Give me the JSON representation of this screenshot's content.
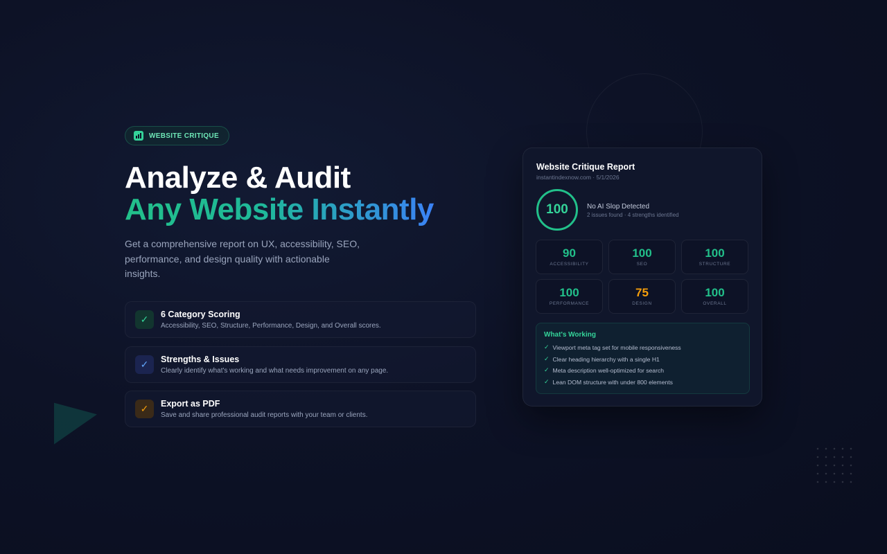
{
  "badge": {
    "label": "WEBSITE CRITIQUE"
  },
  "hero": {
    "title_line1": "Analyze & Audit",
    "title_line2": "Any Website Instantly",
    "lede": "Get a comprehensive report on UX, accessibility, SEO, performance, and design quality with actionable insights."
  },
  "features": [
    {
      "title": "6 Category Scoring",
      "desc": "Accessibility, SEO, Structure, Performance, Design, and Overall scores.",
      "icon": "check-icon",
      "color": "#34d399"
    },
    {
      "title": "Strengths & Issues",
      "desc": "Clearly identify what's working and what needs improvement on any page.",
      "icon": "check-icon",
      "color": "#60a5fa"
    },
    {
      "title": "Export as PDF",
      "desc": "Save and share professional audit reports with your team or clients.",
      "icon": "check-icon",
      "color": "#f59e0b"
    }
  ],
  "report": {
    "title": "Website Critique Report",
    "meta": "instantindexnow.com · 5/1/2026",
    "overall_score": "100",
    "verdict": "No AI Slop Detected",
    "verdict_sub": "2 issues found · 4 strengths identified",
    "scores": [
      {
        "value": "90",
        "label": "ACCESSIBILITY",
        "color": "#22c08a"
      },
      {
        "value": "100",
        "label": "SEO",
        "color": "#22c08a"
      },
      {
        "value": "100",
        "label": "STRUCTURE",
        "color": "#22c08a"
      },
      {
        "value": "100",
        "label": "PERFORMANCE",
        "color": "#22c08a"
      },
      {
        "value": "75",
        "label": "DESIGN",
        "color": "#f59e0b"
      },
      {
        "value": "100",
        "label": "OVERALL",
        "color": "#22c08a"
      }
    ],
    "working_title": "What's Working",
    "working_items": [
      "Viewport meta tag set for mobile responsiveness",
      "Clear heading hierarchy with a single H1",
      "Meta description well-optimized for search",
      "Lean DOM structure with under 800 elements"
    ],
    "check_glyph": "✓"
  },
  "colors": {
    "accent": "#34d399",
    "blue": "#3b82f6",
    "amber": "#f59e0b",
    "background": "#0d1226"
  }
}
